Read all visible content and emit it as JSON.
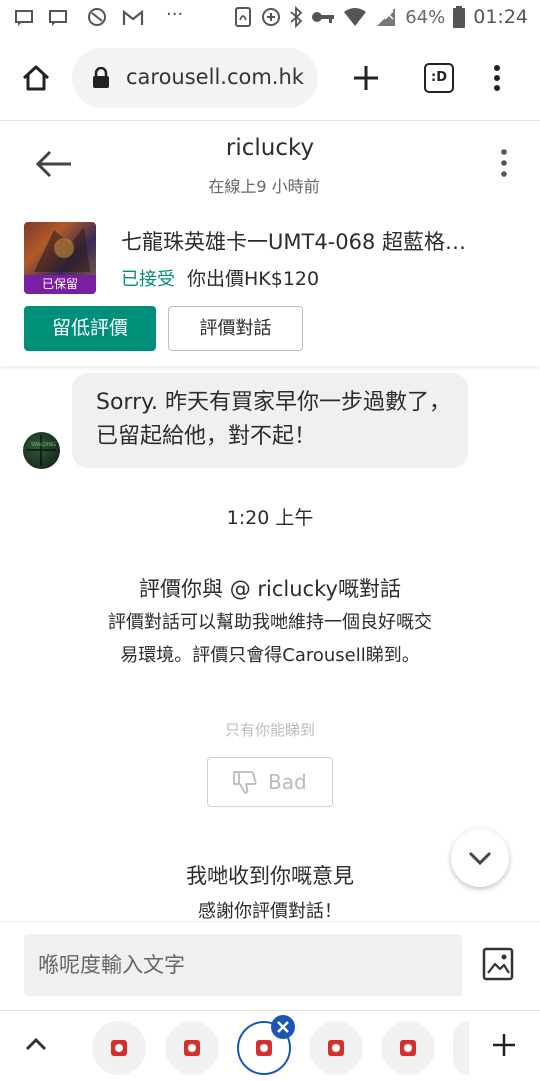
{
  "status_bar": {
    "battery": "64%",
    "time": "01:24"
  },
  "browser": {
    "url": "carousell.com.hk",
    "tab_switch_label": ":D"
  },
  "chat_header": {
    "username": "riclucky",
    "last_seen": "在線上9 小時前",
    "listing": {
      "title": "七龍珠英雄卡一UMT4-068 超藍格…",
      "badge": "已保留",
      "status": "已接受",
      "offer": "你出價HK$120"
    },
    "buttons": {
      "leave_review": "留低評價",
      "review_chat": "評價對話"
    }
  },
  "messages": [
    {
      "text": "Sorry. 昨天有買家早你一步過數了，已留起給他，對不起！"
    }
  ],
  "timestamp": "1:20 上午",
  "review_prompt": {
    "title": "評價你與 @ riclucky嘅對話",
    "description": "評價對話可以幫助我哋維持一個良好嘅交易環境。評價只會得Carousell睇到。",
    "only_you": "只有你能睇到",
    "bad_button": "Bad"
  },
  "feedback": {
    "title": "我哋收到你嘅意見",
    "subtitle": "感謝你評價對話！"
  },
  "composer": {
    "placeholder": "喺呢度輸入文字"
  },
  "colors": {
    "accent": "#008f79",
    "badge": "#7a1fa2",
    "active_tab": "#1a56b8"
  }
}
